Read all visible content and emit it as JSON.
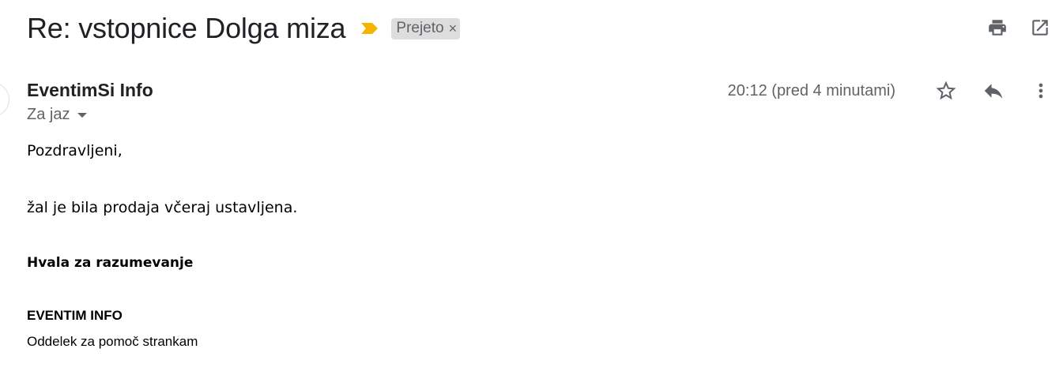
{
  "header": {
    "subject": "Re: vstopnice Dolga miza",
    "label": "Prejeto",
    "label_close": "×",
    "importance_color": "#f4b400",
    "icons": [
      "print-icon",
      "open-in-new-window-icon"
    ]
  },
  "message": {
    "sender": "EventimSi Info",
    "recipient": "Za jaz",
    "timestamp": "20:12 (pred 4 minutami)",
    "icons": [
      "star-icon",
      "reply-icon",
      "more-vert-icon"
    ]
  },
  "body": {
    "greeting": "Pozdravljeni,",
    "line1": "žal je bila prodaja včeraj ustavljena.",
    "thanks": "Hvala za razumevanje",
    "signature_name": "EVENTIM INFO",
    "signature_dept": "Oddelek za pomoč strankam"
  },
  "colors": {
    "text_primary": "#202124",
    "text_secondary": "#5f6368",
    "chip_bg": "#dddddd"
  }
}
